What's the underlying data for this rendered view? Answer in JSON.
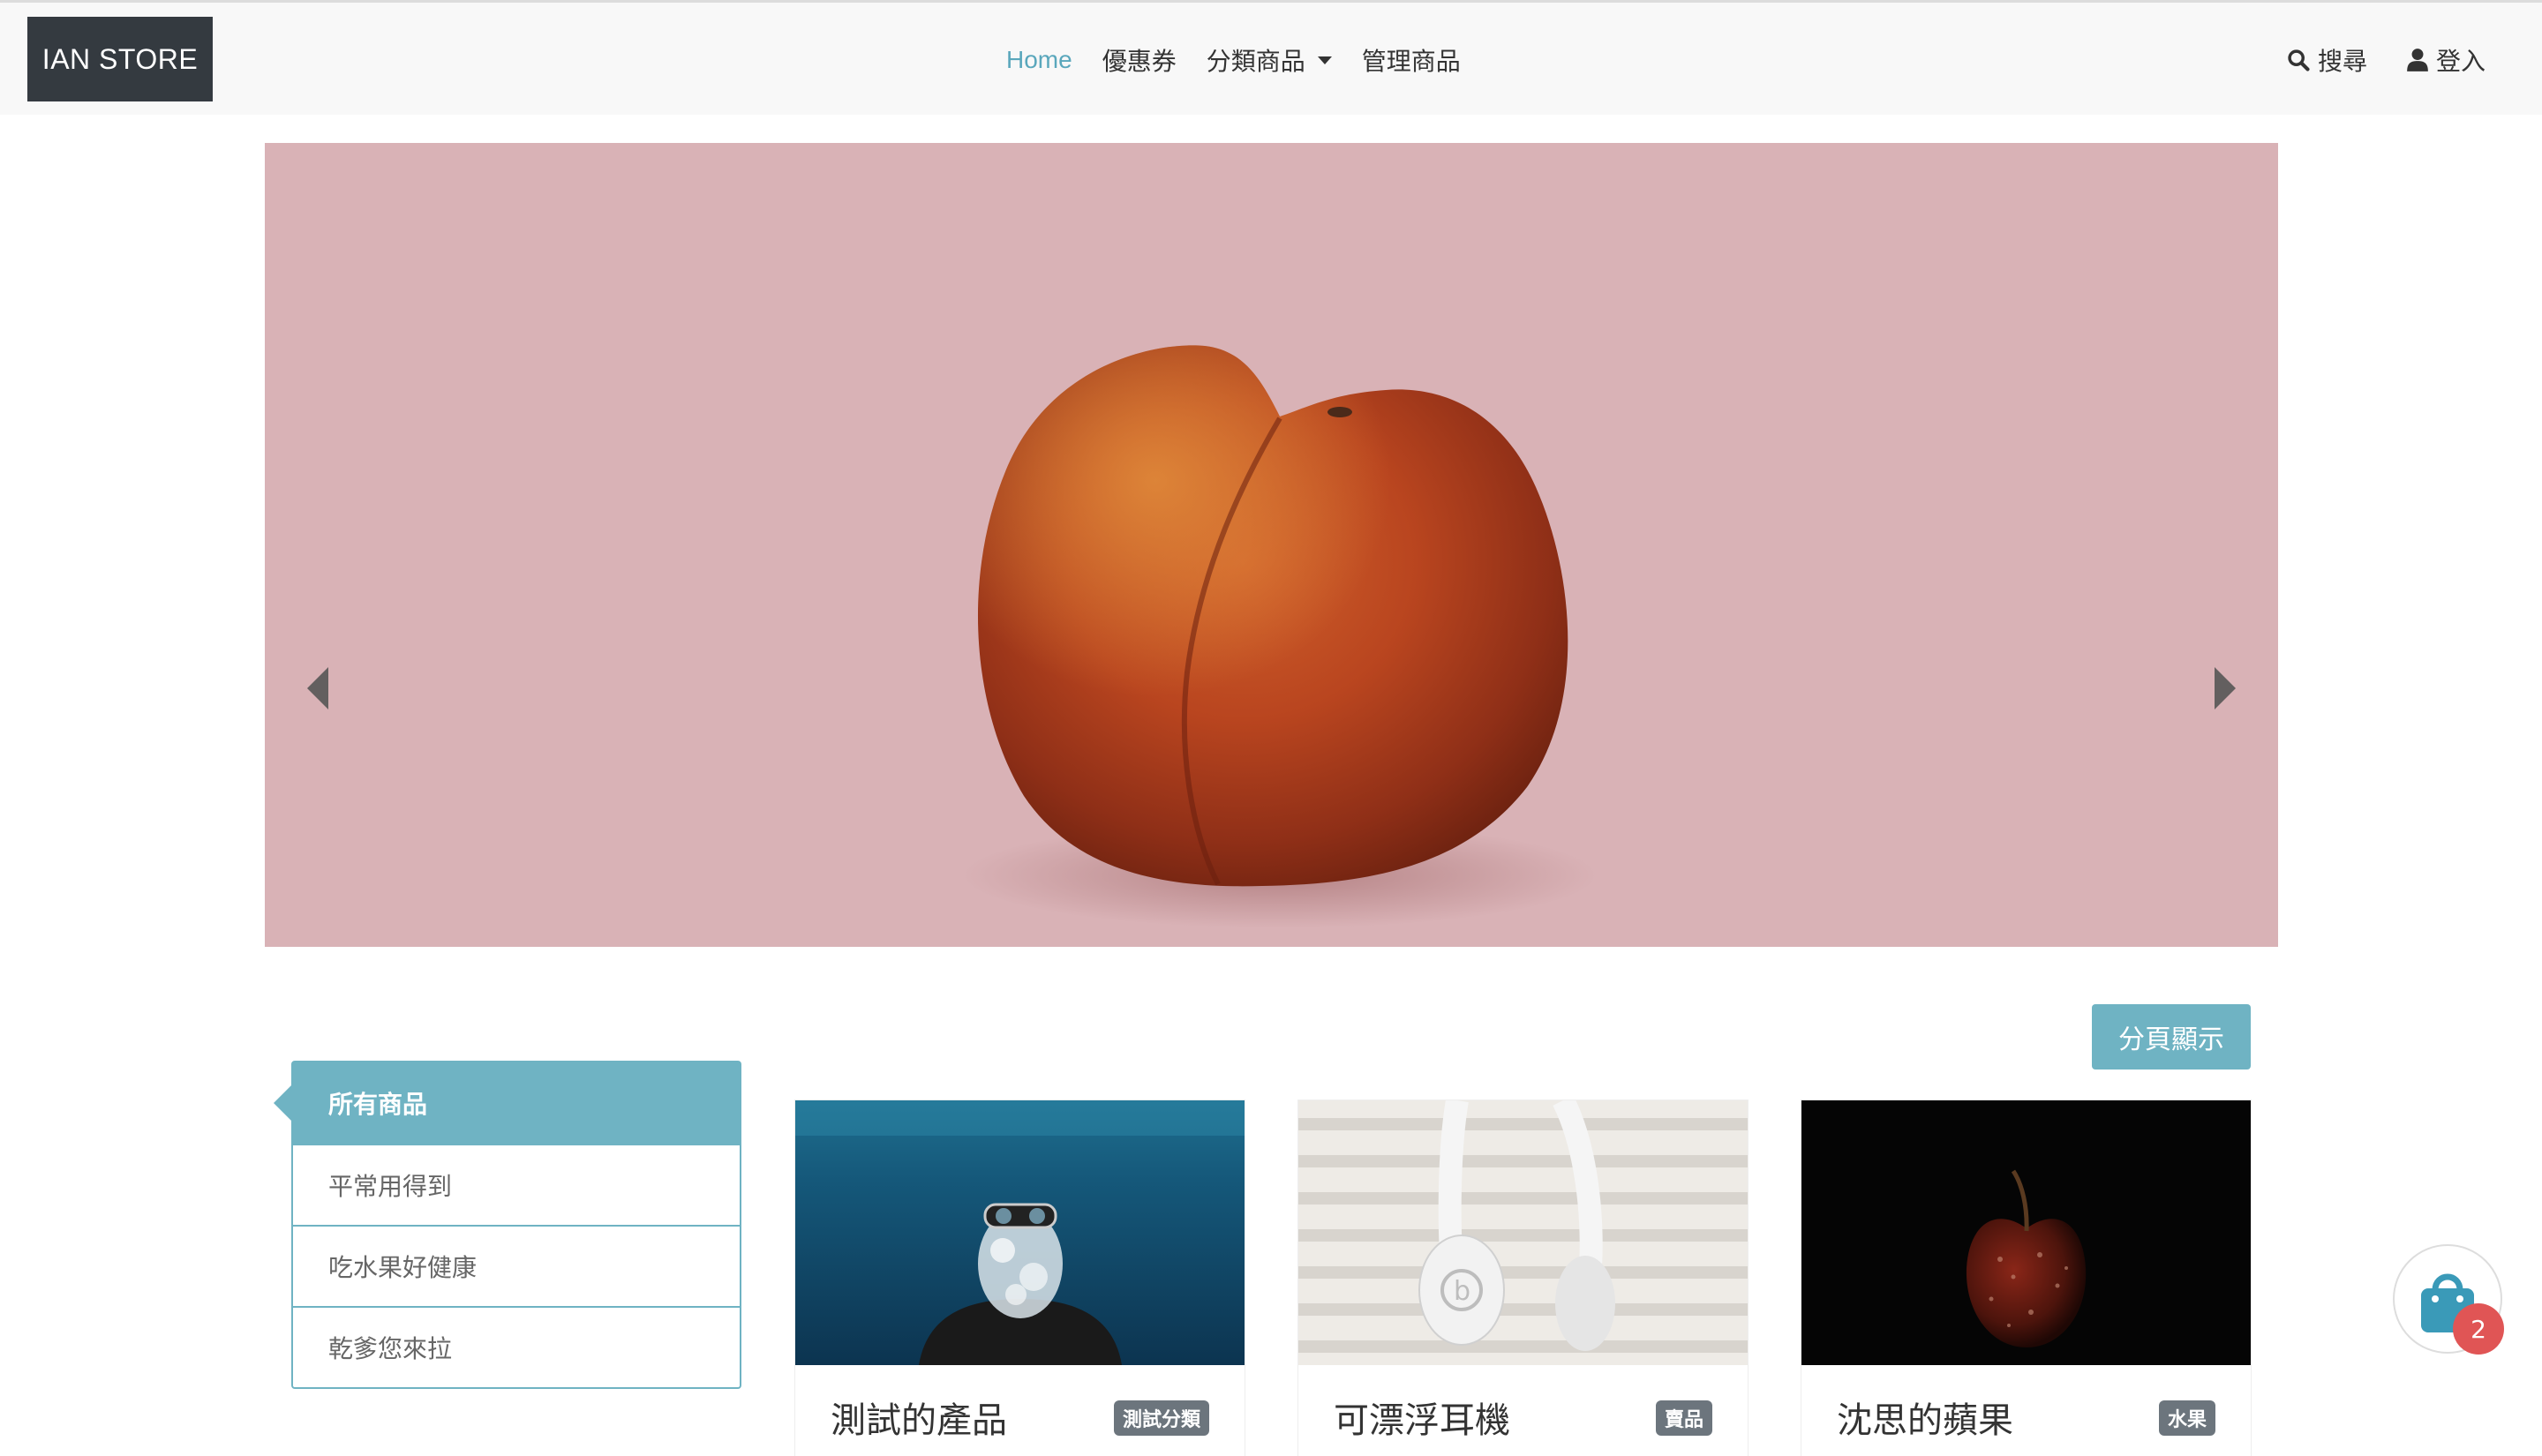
{
  "navbar": {
    "brand": "IAN STORE",
    "links": [
      {
        "label": "Home"
      },
      {
        "label": "優惠券"
      },
      {
        "label": "分類商品"
      },
      {
        "label": "管理商品"
      }
    ],
    "search_label": "搜尋",
    "login_label": "登入"
  },
  "pagination_button": "分頁顯示",
  "categories": [
    {
      "label": "所有商品"
    },
    {
      "label": "平常用得到"
    },
    {
      "label": "吃水果好健康"
    },
    {
      "label": "乾爹您來拉"
    }
  ],
  "products": [
    {
      "title": "測試的產品",
      "badge": "測試分類"
    },
    {
      "title": "可漂浮耳機",
      "badge": "賣品"
    },
    {
      "title": "沈思的蘋果",
      "badge": "水果"
    }
  ],
  "cart": {
    "count": "2"
  },
  "colors": {
    "accent": "#6fb3c3",
    "brand_bg": "#343a40",
    "carousel_bg": "#d9b2b6",
    "badge_bg": "#6c757d",
    "cart_badge": "#e05555"
  }
}
